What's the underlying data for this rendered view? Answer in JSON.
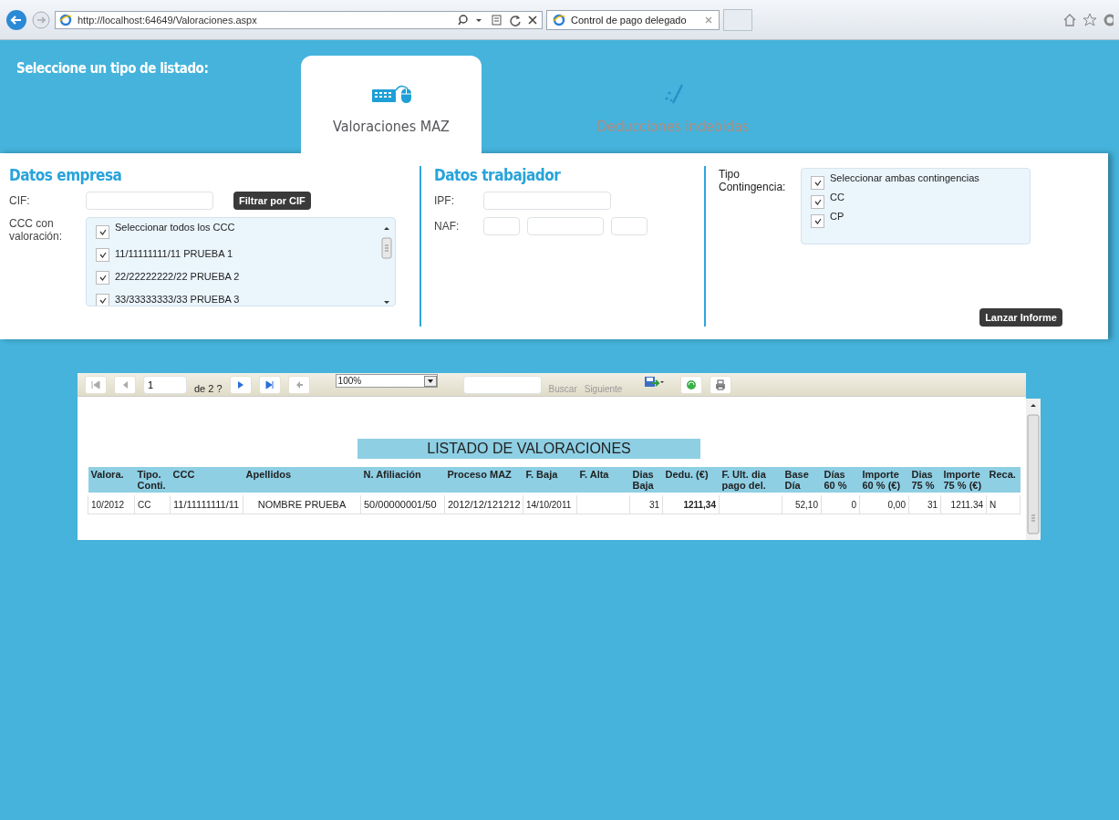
{
  "browser": {
    "url": "http://localhost:64649/Valoraciones.aspx",
    "tab_title": "Control de pago delegado"
  },
  "heading": "Seleccione un tipo de listado:",
  "report_tabs": [
    {
      "label": "Valoraciones MAZ",
      "selected": true,
      "kind": "keyboard"
    },
    {
      "label": "Deducciones indebidas",
      "selected": false,
      "kind": "pen"
    }
  ],
  "empresa": {
    "title": "Datos empresa",
    "cif_label": "CIF:",
    "filter_button": "Filtrar por CIF",
    "ccc_label": "CCC con valoración:",
    "ccc_items": [
      {
        "label": "Seleccionar todos los CCC",
        "checked": true
      },
      {
        "label": "11/11111111/11 PRUEBA 1",
        "checked": true
      },
      {
        "label": "22/22222222/22 PRUEBA 2",
        "checked": true
      },
      {
        "label": "33/33333333/33 PRUEBA 3",
        "checked": true
      }
    ]
  },
  "trabajador": {
    "title": "Datos trabajador",
    "ipf_label": "IPF:",
    "naf_label": "NAF:"
  },
  "contingencia": {
    "label": "Tipo Contingencia:",
    "items": [
      {
        "label": "Seleccionar ambas contingencias",
        "checked": true
      },
      {
        "label": "CC",
        "checked": true
      },
      {
        "label": "CP",
        "checked": true
      }
    ],
    "submit_button": "Lanzar Informe"
  },
  "viewer": {
    "page": "1",
    "page_count": "de 2 ?",
    "zoom": "100%",
    "find": "Buscar",
    "find_next": "Siguiente"
  },
  "report": {
    "title": "LISTADO DE VALORACIONES",
    "columns": [
      "Valora.",
      "Tipo. Conti.",
      "CCC",
      "Apellidos",
      "N. Afiliación",
      "Proceso MAZ",
      "F. Baja",
      "F. Alta",
      "Dias Baja",
      "Dedu. (€)",
      "F. Ult. dia pago del.",
      "Base Día",
      "Días 60 %",
      "Importe 60 % (€)",
      "Dias 75 %",
      "Importe 75 % (€)",
      "Reca."
    ],
    "rows": [
      [
        "10/2012",
        "CC",
        "11/11111111/11",
        "NOMBRE PRUEBA",
        "50/00000001/50",
        "2012/12/121212",
        "14/10/2011",
        "",
        "31",
        "1211,34",
        "",
        "52,10",
        "0",
        "0,00",
        "31",
        "1211.34",
        "N"
      ]
    ]
  }
}
